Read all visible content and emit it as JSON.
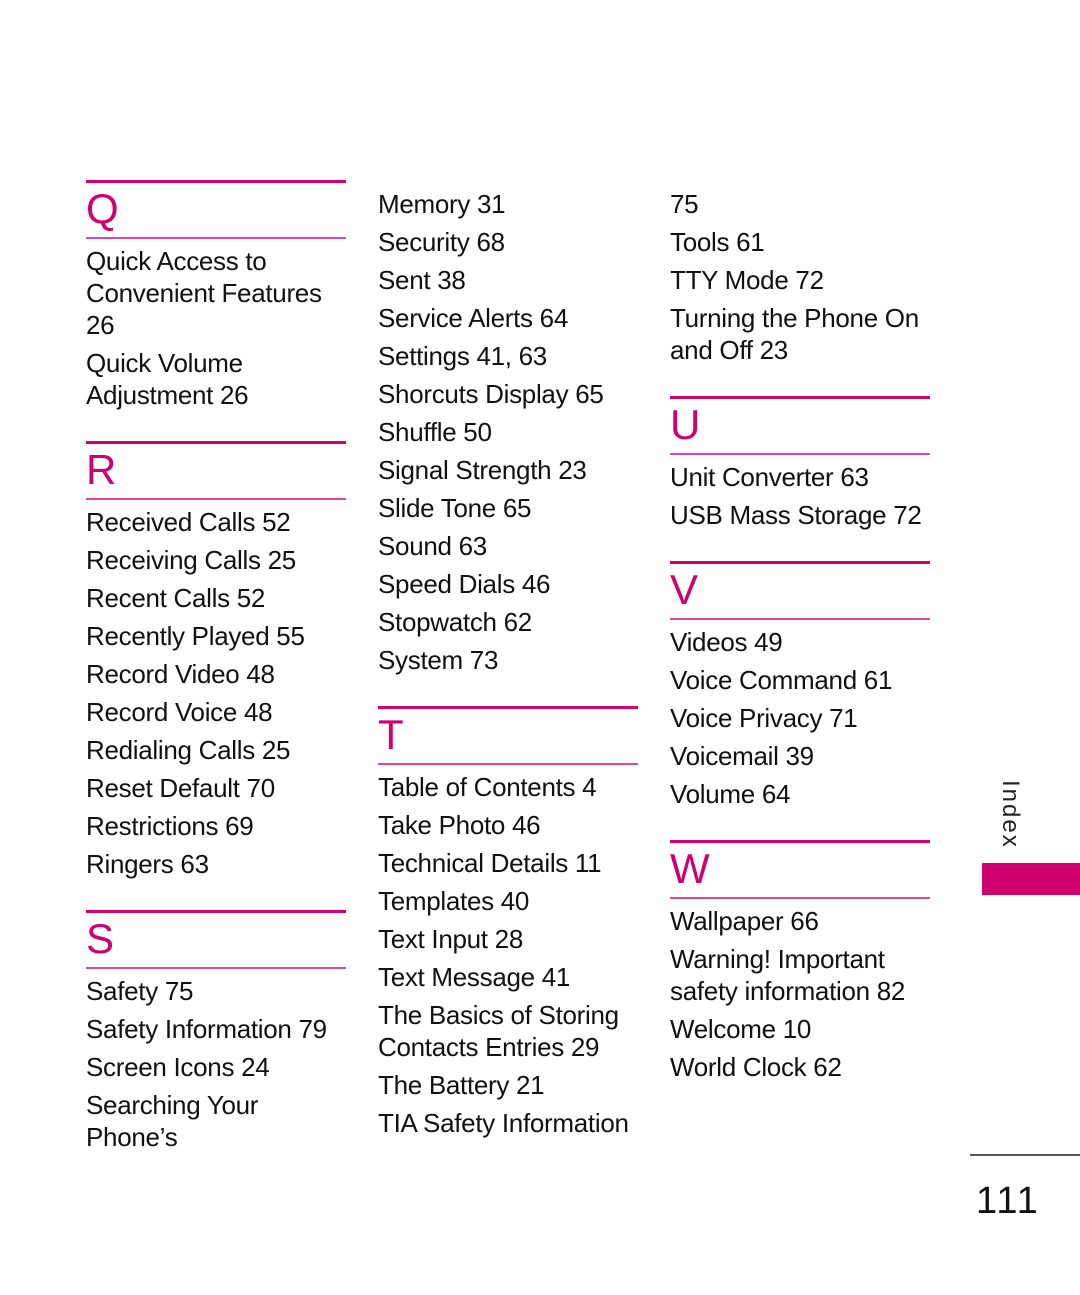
{
  "accent_color": "#d1006f",
  "columns": [
    {
      "continued_entries": [],
      "sections": [
        {
          "letter": "Q",
          "entries": [
            "Quick Access to Convenient Features 26",
            "Quick Volume Adjustment 26"
          ]
        },
        {
          "letter": "R",
          "entries": [
            "Received Calls 52",
            "Receiving Calls 25",
            "Recent Calls 52",
            "Recently Played 55",
            "Record Video 48",
            "Record Voice 48",
            "Redialing Calls 25",
            "Reset Default 70",
            "Restrictions 69",
            "Ringers 63"
          ]
        },
        {
          "letter": "S",
          "entries": [
            "Safety 75",
            "Safety Information 79",
            "Screen Icons 24",
            "Searching Your Phone’s"
          ]
        }
      ]
    },
    {
      "continued_entries": [
        "Memory 31",
        "Security 68",
        "Sent 38",
        "Service Alerts 64",
        "Settings 41, 63",
        "Shorcuts Display 65",
        "Shuffle 50",
        "Signal Strength 23",
        "Slide Tone 65",
        "Sound 63",
        "Speed Dials 46",
        "Stopwatch 62",
        "System 73"
      ],
      "sections": [
        {
          "letter": "T",
          "entries": [
            "Table of Contents 4",
            "Take Photo 46",
            "Technical Details 11",
            "Templates 40",
            "Text Input 28",
            "Text Message 41",
            "The Basics of Storing Contacts Entries 29",
            "The Battery 21",
            "TIA Safety Information"
          ]
        }
      ]
    },
    {
      "continued_entries": [
        "75",
        "Tools 61",
        "TTY Mode 72",
        "Turning the Phone On and Off 23"
      ],
      "sections": [
        {
          "letter": "U",
          "entries": [
            "Unit Converter 63",
            "USB Mass Storage 72"
          ]
        },
        {
          "letter": "V",
          "entries": [
            "Videos 49",
            "Voice Command 61",
            "Voice Privacy 71",
            "Voicemail 39",
            "Volume 64"
          ]
        },
        {
          "letter": "W",
          "entries": [
            "Wallpaper 66",
            "Warning! Important safety information 82",
            "Welcome 10",
            "World Clock 62"
          ]
        }
      ]
    }
  ],
  "side_tab": {
    "label": "Index"
  },
  "page_number": "111"
}
